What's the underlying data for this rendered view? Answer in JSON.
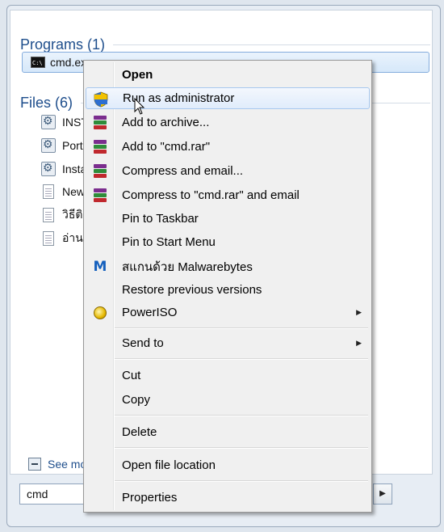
{
  "programs_group": {
    "title": "Programs (1)"
  },
  "program_item": {
    "label": "cmd.exe"
  },
  "files_group": {
    "title": "Files (6)"
  },
  "files": [
    {
      "label": "INSTALL",
      "icon": "gear-file-icon"
    },
    {
      "label": "Portable",
      "icon": "gear-file-icon"
    },
    {
      "label": "Install",
      "icon": "gear-file-icon"
    },
    {
      "label": "New Text",
      "icon": "document-icon"
    },
    {
      "label": "วิธีติดตั้ง",
      "icon": "document-icon"
    },
    {
      "label": "อ่าน.txt",
      "icon": "document-icon"
    }
  ],
  "see_more": {
    "label": "See more results"
  },
  "search": {
    "value": "cmd"
  },
  "context_menu": {
    "open": "Open",
    "run_as_admin": "Run as administrator",
    "add_to_archive": "Add to archive...",
    "add_to_cmd_rar": "Add to \"cmd.rar\"",
    "compress_and_email": "Compress and email...",
    "compress_to_cmd_rar_email": "Compress to \"cmd.rar\" and email",
    "pin_to_taskbar": "Pin to Taskbar",
    "pin_to_start_menu": "Pin to Start Menu",
    "scan_malwarebytes": "สแกนด้วย Malwarebytes",
    "restore_previous_versions": "Restore previous versions",
    "poweriso": "PowerISO",
    "send_to": "Send to",
    "cut": "Cut",
    "copy": "Copy",
    "delete": "Delete",
    "open_file_location": "Open file location",
    "properties": "Properties"
  },
  "colors": {
    "accent_header": "#1e4e8c",
    "hover_border": "#a8c8ee",
    "menu_background": "#f0f0f0"
  }
}
